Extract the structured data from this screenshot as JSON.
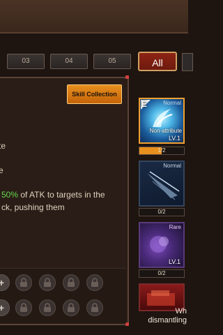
{
  "tabs": [
    "03",
    "04",
    "05"
  ],
  "filter": {
    "all_label": "All"
  },
  "panel": {
    "skill_collection_label": "Skill Collection",
    "desc_line_1_tail": "te",
    "desc_line_2_tail": "e",
    "desc_line_3_percent": "50%",
    "desc_line_3_rest": " of ATK to targets in the",
    "desc_line_4": "ck, pushing them"
  },
  "cards": [
    {
      "grade_letter": "E",
      "rarity": "Normal",
      "attribute": "Non-attribute",
      "level": "LV.1",
      "count": "1/2",
      "progress": 0.5,
      "selected": true
    },
    {
      "rarity": "Normal",
      "count": "0/2",
      "progress": 0,
      "selected": false
    },
    {
      "rarity": "Rare",
      "level": "LV.1",
      "count": "0/2",
      "progress": 0,
      "selected": false
    }
  ],
  "bottom_hint": {
    "line_1": "Wh",
    "line_2": "dismantling"
  },
  "colors": {
    "accent_orange": "#e8901e",
    "all_button_red": "#8c2414",
    "highlight_green": "#64d84c"
  }
}
